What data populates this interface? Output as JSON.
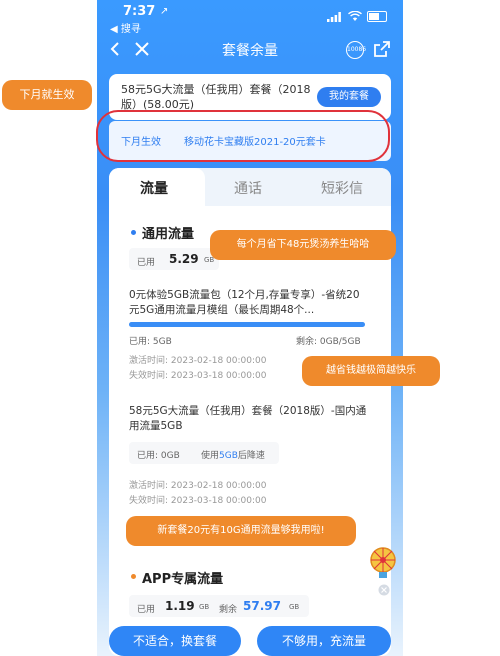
{
  "status": {
    "time": "7:37",
    "location": "↗",
    "back_app": "◀ 搜寻"
  },
  "nav": {
    "title": "套餐余量",
    "badge": "10086"
  },
  "plan": {
    "name": "58元5G大流量（任我用）套餐（2018版）(58.00元)",
    "my_plan": "我的套餐"
  },
  "pending": {
    "label": "下月生效",
    "name": "移动花卡宝藏版2021-20元套卡"
  },
  "tabs": [
    {
      "label": "流量"
    },
    {
      "label": "通话"
    },
    {
      "label": "短彩信"
    }
  ],
  "general": {
    "title": "通用流量",
    "used_label": "已用",
    "used_value": "5.29",
    "used_unit": "GB"
  },
  "package1": {
    "desc": "0元体验5GB流量包（12个月,存量专享）-省统20元5G通用流量月模组（最长周期48个...",
    "used": "已用: 5GB",
    "remain": "剩余: 0GB/5GB",
    "progress": 1.0,
    "activate": "激活时间: 2023-02-18 00:00:00",
    "expire": "失效时间: 2023-03-18 00:00:00"
  },
  "package2": {
    "desc": "58元5G大流量（任我用）套餐（2018版）-国内通用流量5GB",
    "used_prefix": "已用: 0GB",
    "rule_prefix": "使用",
    "rule_highlight": "5GB",
    "rule_suffix": "后降速",
    "activate": "激活时间: 2023-02-18 00:00:00",
    "expire": "失效时间: 2023-03-18 00:00:00"
  },
  "app_section": {
    "title": "APP专属流量",
    "used_label": "已用",
    "used_value": "1.19",
    "used_unit": "GB",
    "remain_label": "剩余",
    "remain_value": "57.97",
    "remain_unit": "GB"
  },
  "buttons": {
    "change": "不适合，换套餐",
    "recharge": "不够用，充流量"
  },
  "annotations": {
    "next_month": "下月就生效",
    "save": "每个月省下48元煲汤养生哈哈",
    "simple": "越省钱越极简越快乐",
    "enough": "新套餐20元有10G通用流量够我用啦!"
  },
  "colors": {
    "accent": "#2f7ef0",
    "callout": "#ef8a2c",
    "ring": "#e0323b"
  }
}
